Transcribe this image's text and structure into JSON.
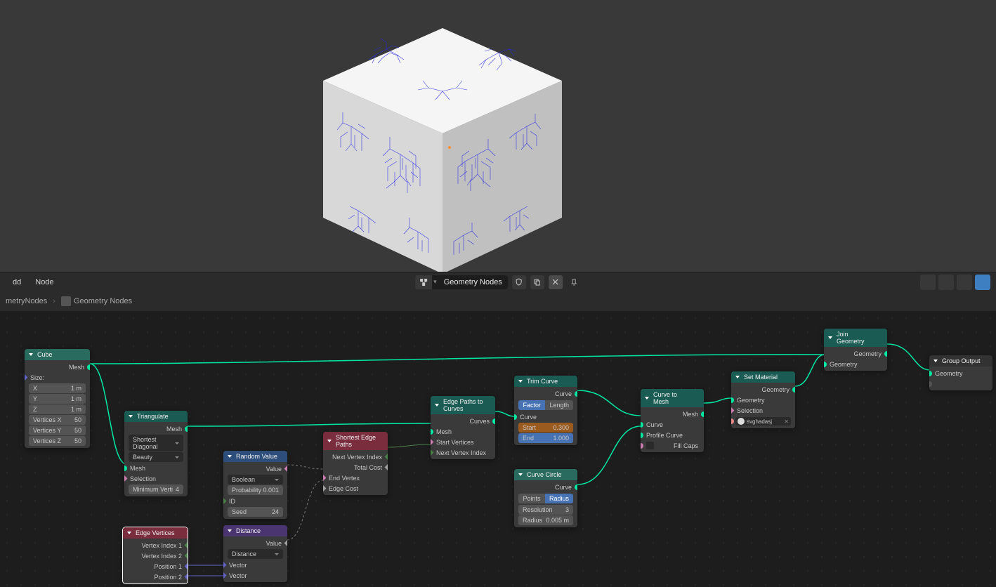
{
  "viewport": {},
  "header": {
    "menu_add": "dd",
    "menu_node": "Node",
    "datablock_name": "Geometry Nodes"
  },
  "breadcrumb": {
    "parent": "metryNodes",
    "current": "Geometry Nodes"
  },
  "nodes": {
    "cube": {
      "title": "Cube",
      "out_mesh": "Mesh",
      "in_size": "Size:",
      "x_label": "X",
      "x_val": "1 m",
      "y_label": "Y",
      "y_val": "1 m",
      "z_label": "Z",
      "z_val": "1 m",
      "vx_label": "Vertices X",
      "vx_val": "50",
      "vy_label": "Vertices Y",
      "vy_val": "50",
      "vz_label": "Vertices Z",
      "vz_val": "50"
    },
    "triangulate": {
      "title": "Triangulate",
      "out_mesh": "Mesh",
      "sel1": "Shortest Diagonal",
      "sel2": "Beauty",
      "in_mesh": "Mesh",
      "in_selection": "Selection",
      "min_label": "Minimum Verti",
      "min_val": "4"
    },
    "edge_vertices": {
      "title": "Edge Vertices",
      "out_vi1": "Vertex Index 1",
      "out_vi2": "Vertex Index 2",
      "out_p1": "Position 1",
      "out_p2": "Position 2"
    },
    "random_value": {
      "title": "Random Value",
      "out_value": "Value",
      "sel_type": "Boolean",
      "prob_label": "Probability",
      "prob_val": "0.001",
      "in_id": "ID",
      "seed_label": "Seed",
      "seed_val": "24"
    },
    "distance": {
      "title": "Distance",
      "out_value": "Value",
      "sel_type": "Distance",
      "in_vec1": "Vector",
      "in_vec2": "Vector"
    },
    "shortest_edge": {
      "title": "Shortest Edge Paths",
      "out_nvi": "Next Vertex Index",
      "out_tc": "Total Cost",
      "in_ev": "End Vertex",
      "in_ec": "Edge Cost"
    },
    "edge_paths": {
      "title": "Edge Paths to Curves",
      "out_curves": "Curves",
      "in_mesh": "Mesh",
      "in_sv": "Start Vertices",
      "in_nvi": "Next Vertex Index"
    },
    "trim_curve": {
      "title": "Trim Curve",
      "out_curve": "Curve",
      "tog_factor": "Factor",
      "tog_length": "Length",
      "in_curve": "Curve",
      "start_label": "Start",
      "start_val": "0.300",
      "end_label": "End",
      "end_val": "1.000"
    },
    "curve_circle": {
      "title": "Curve Circle",
      "out_curve": "Curve",
      "tog_points": "Points",
      "tog_radius": "Radius",
      "res_label": "Resolution",
      "res_val": "3",
      "rad_label": "Radius",
      "rad_val": "0.005 m"
    },
    "curve_to_mesh": {
      "title": "Curve to Mesh",
      "out_mesh": "Mesh",
      "in_curve": "Curve",
      "in_profile": "Profile Curve",
      "in_fillcaps": "Fill Caps"
    },
    "set_material": {
      "title": "Set Material",
      "out_geo": "Geometry",
      "in_geo": "Geometry",
      "in_sel": "Selection",
      "mat_name": "svghadasj"
    },
    "join_geometry": {
      "title": "Join Geometry",
      "out_geo": "Geometry",
      "in_geo": "Geometry"
    },
    "group_output": {
      "title": "Group Output",
      "in_geo": "Geometry"
    }
  }
}
